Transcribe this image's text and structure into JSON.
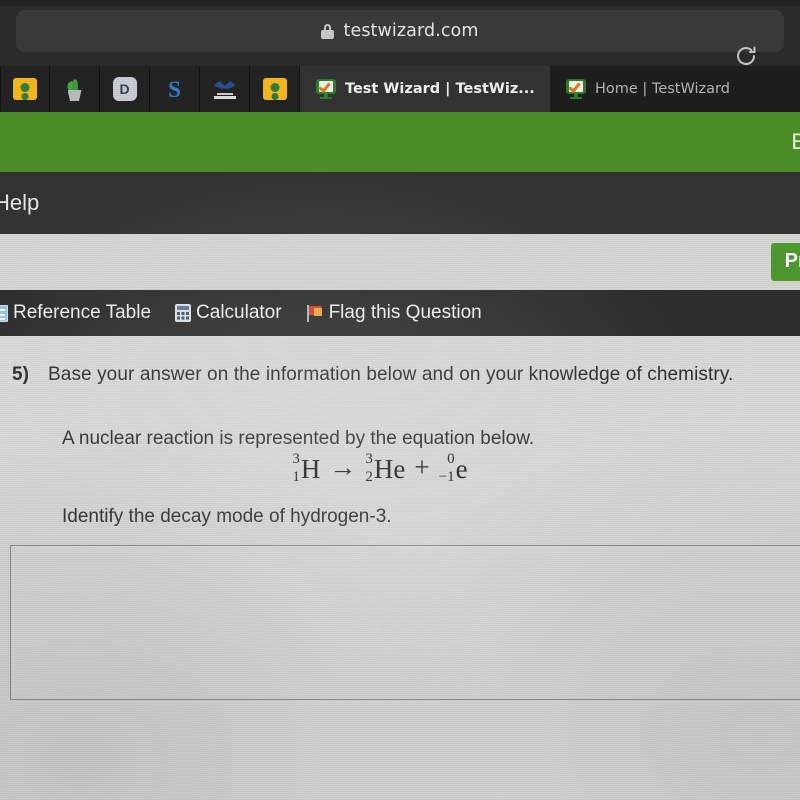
{
  "browser": {
    "url": "testwizard.com",
    "lock_icon": "lock-icon",
    "reload_icon": "reload-icon",
    "bookmarks": [
      {
        "name": "google-classroom",
        "icon": "classroom-icon"
      },
      {
        "name": "plant-site",
        "icon": "plant-icon"
      },
      {
        "name": "d-site",
        "icon": "letter-d-icon",
        "letter": "D"
      },
      {
        "name": "schoology",
        "icon": "letter-s-icon",
        "letter": "S"
      },
      {
        "name": "eagle-school",
        "icon": "eagle-icon"
      },
      {
        "name": "google-classroom-2",
        "icon": "classroom-icon"
      }
    ],
    "tabs": [
      {
        "title": "Test Wizard | TestWiz...",
        "active": true,
        "favicon": "testwizard-icon"
      },
      {
        "title": "Home | TestWizard",
        "active": false,
        "favicon": "testwizard-icon"
      }
    ]
  },
  "app": {
    "brandbar": {
      "right_label": "E"
    },
    "navbar": {
      "help_label": "Help"
    },
    "preview_button": "Prev",
    "toolbar": [
      {
        "label": "Reference Table",
        "icon": "reference-table-icon"
      },
      {
        "label": "Calculator",
        "icon": "calculator-icon"
      },
      {
        "label": "Flag this Question",
        "icon": "flag-icon"
      }
    ]
  },
  "question": {
    "number": "5)",
    "stem": "Base your answer on the information below and on your knowledge of chemistry.",
    "line1": "A nuclear reaction is represented by the equation below.",
    "prompt": "Identify the decay mode of hydrogen-3.",
    "equation": {
      "reactant": {
        "superscript": "3",
        "subscript": "1",
        "symbol": "H"
      },
      "arrow": "→",
      "product1": {
        "superscript": "3",
        "subscript": "2",
        "symbol": "He"
      },
      "plus": "+",
      "product2": {
        "superscript": "0",
        "subscript": "−1",
        "symbol": "e"
      }
    },
    "answer_value": ""
  },
  "colors": {
    "brand_green": "#4c8f26",
    "button_green": "#4f9a2f",
    "nav_dark": "#333333",
    "toolbar_dark": "#2e2e2e",
    "page_bg": "#d9d9d5"
  }
}
